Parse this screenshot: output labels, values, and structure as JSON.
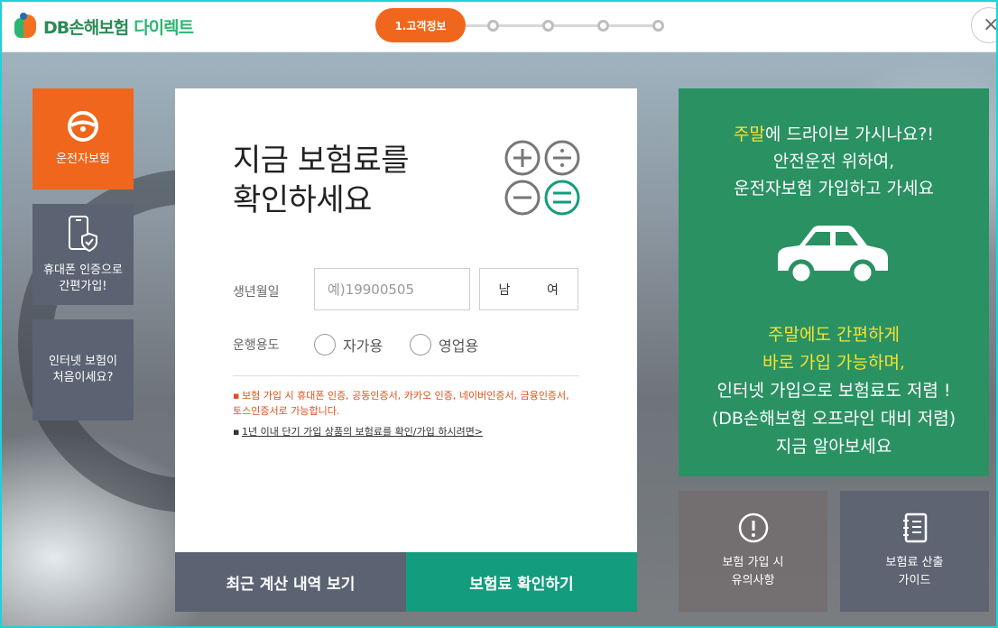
{
  "header": {
    "logo_main": "DB손해보험",
    "logo_sub": "다이렉트",
    "steps": {
      "active_label": "1.고객정보",
      "remaining_count_icon": "step-dot"
    },
    "close_label": "×"
  },
  "sidebar": {
    "items": [
      {
        "label": "운전자보험",
        "icon": "steering-wheel-icon"
      },
      {
        "label": "휴대폰 인증으로\n간편가입!",
        "icon": "phone-shield-icon"
      },
      {
        "label": "인터넷 보험이\n처음이세요?"
      }
    ]
  },
  "form": {
    "title": "지금 보험료를\n확인하세요",
    "birth_label": "생년월일",
    "birth_placeholder": "예)19900505",
    "gender_male": "남",
    "gender_female": "여",
    "usage_label": "운행용도",
    "usage_options": [
      "자가용",
      "영업용"
    ],
    "note_1": "보험 가입 시 휴대폰 인증, 공동인증서, 카카오 인증, 네이버인증서, 금융인증서, 토스인증서로 가능합니다.",
    "note_2": "1년 이내 단기 가입 상품의 보험료를 확인/가입 하시려면>",
    "bullet": "▪"
  },
  "buttons": {
    "recent": "최근 계산 내역 보기",
    "check": "보험료 확인하기"
  },
  "promo": {
    "top_highlight": "주말",
    "top_line1_rest": "에 드라이브 가시나요?!",
    "top_line2": "안전운전 위하여,",
    "top_line3": "운전자보험 가입하고 가세요",
    "bottom_line1": "주말에도 간편하게",
    "bottom_line2": "바로 가입 가능하며,",
    "bottom_line3": "인터넷 가입으로 보험료도 저렴 !",
    "bottom_line4": "(DB손해보험 오프라인 대비 저렴)",
    "bottom_line5": "지금 알아보세요"
  },
  "guides": [
    {
      "label": "보험 가입 시\n유의사항",
      "icon": "exclamation-circle-icon"
    },
    {
      "label": "보험료 산출\n가이드",
      "icon": "notebook-icon"
    }
  ],
  "colors": {
    "accent_orange": "#f0661c",
    "slate": "#5b6372",
    "teal": "#139c7e",
    "promo_green": "#2a9163",
    "highlight_yellow": "#f6e233"
  }
}
